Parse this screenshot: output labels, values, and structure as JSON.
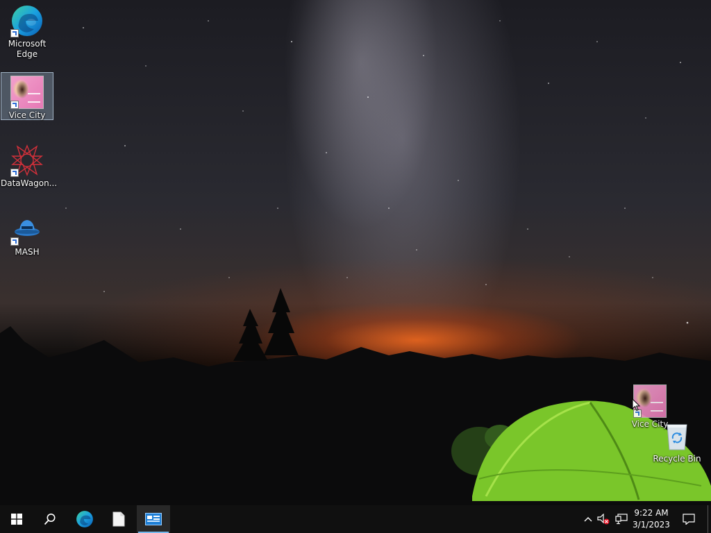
{
  "desktop": {
    "icons": [
      {
        "label_line1": "Microsoft",
        "label_line2": "Edge",
        "icon": "edge-icon"
      },
      {
        "label": "Vice City",
        "icon": "vice-city-icon",
        "selected": true
      },
      {
        "label": "DataWagon...",
        "icon": "datawagon-icon"
      },
      {
        "label": "MASH",
        "icon": "mash-icon"
      },
      {
        "label": "Vice City",
        "icon": "vice-city-icon",
        "being_dragged": true
      },
      {
        "label": "Recycle Bin",
        "icon": "recycle-bin-icon"
      }
    ]
  },
  "taskbar": {
    "buttons": [
      {
        "icon": "windows-start-icon"
      },
      {
        "icon": "search-icon"
      },
      {
        "icon": "edge-icon"
      },
      {
        "icon": "file-icon"
      },
      {
        "icon": "app-window-icon",
        "active": true
      }
    ],
    "tray": {
      "icons": [
        "chevron-up-icon",
        "volume-muted-icon",
        "network-icon",
        "notification-icon"
      ],
      "time": "9:22 AM",
      "date": "3/1/2023"
    }
  },
  "colors": {
    "taskbar": "#101010",
    "accent": "#76b9ed",
    "tent": "#7ac62a"
  }
}
